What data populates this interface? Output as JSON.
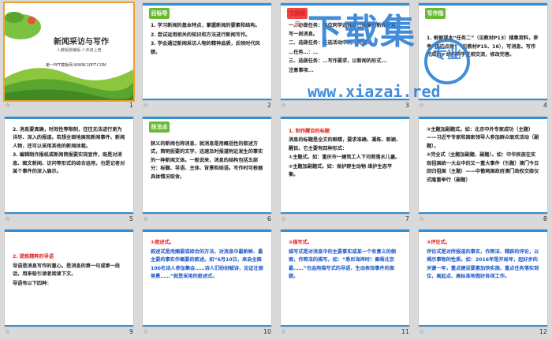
{
  "slides": [
    {
      "num": "1",
      "title": "新闻采访与写作",
      "subtitle": "人教版部编版·八年级上册",
      "footer": "第一PPT模板网-WWW.1PPT.COM"
    },
    {
      "num": "2",
      "badge": "目标导航",
      "lines": [
        "1. 学习新闻的基本特点，掌握新闻的要素和结构。",
        "2. 尝试运用相关的知识和方法进行新闻写作。",
        "3. 学会通过新闻采访人物的精神品质，反映时代风貌。"
      ]
    },
    {
      "num": "3",
      "badge": "文题展示",
      "lines": [
        "一、必做任务：每位同学选择自己搜集的新闻材料，写一则消息。",
        "二、选做任务：任选活动中的...完成...",
        "…任务…：…",
        "三、选做任务：…写作要求，以新闻的形式...",
        "注意事项..."
      ]
    },
    {
      "num": "4",
      "badge": "写作指导",
      "lines": [
        "1. 根据课本“任务二”（见教材P13）搜集资料，参考“技巧点拨”（见教材P15、16），写消息。写作完成后，组内同学互相交流，修改完善。"
      ]
    },
    {
      "num": "5",
      "lines": [
        "2. 消息要真确，时效性等限制，往往无法进行更为详尽、深入的报道。若想全面地展现新闻事件、新闻人物，还可以采用其他的新闻体裁。",
        "3. 编辑制作报纸或新闻简报要实现宣传，既是对消息、图文新闻、访问等形式的综合运用，也是记者对某个事件的深入展示。"
      ]
    },
    {
      "num": "6",
      "badge": "技法点拨",
      "lines": [
        "狭义的新闻也称消息，就消息是用概括性的叙述方式，简明扼要的文字，迅速及时报道附近发生的事实的一种新闻文体。一般说来，消息的结构包括五部分：标题、导语、主体、背景和结语。写作时可根据具体情况取舍。"
      ]
    },
    {
      "num": "7",
      "heading": "1. 制作醒目的标题",
      "lines": [
        "消息的标题是全文的眼睛，要求准确、凝练、新颖、醒目。它主要有四种形式：",
        "①主题式。如：重庆市一建筑工人下河救落水儿童。",
        "②主题加副题式。如：保护野生动物 维护生态平衡。"
      ]
    },
    {
      "num": "8",
      "lines": [
        "③主题加副题式。如：北京中外专家成功（主题）——习近平专家和国家领导人参加群众联欢活动（副题）。",
        "④完全式（主题加副题、副题）。如：中华民族在实现祖国统一大业中的又一重大事件（引题）澳门今日回归祖国（主题）——中葡两国政府澳门政权交接仪式隆重举行（副题）"
      ]
    },
    {
      "num": "9",
      "heading": "2. 提炼精粹的导语",
      "lines": [
        "导语是消息写作的重心。是消息的第一句或第一段话，用来吸引读者阅读下文。",
        "导语有以下四种："
      ]
    },
    {
      "num": "10",
      "lines": [
        "①叙述式。",
        "叙述式是用摘要或综合的方法，对消息中最新鲜、最主要的事实作概要的叙述。如“6月10日，来自全国100名诗人参加集会……诗人们纷纷赋诗，见证壮丽美景……”就是采用的叙述式。"
      ]
    },
    {
      "num": "11",
      "lines": [
        "②描写式。",
        "描写式是对消息中的主要事实或某一个有意义的侧面，作简洁的描写。如：“悉尼海岸时！秦晤北京最……”也运用描写式的导语，生动表现事件的面貌。"
      ]
    },
    {
      "num": "12",
      "lines": [
        "③评论式。",
        "评论式是对所报道的事实，作简洁、精辟的评论，以揭示事物的性质。如：2016年是开局年，起好步的关键一年，重点建设要素加快实施、重点任务落实到位，高起点、高标准地做好各项工作。"
      ]
    }
  ],
  "footer_star": "☆",
  "watermark": {
    "text": "下载集",
    "badge": "专业",
    "url": "www.xiazai.red"
  }
}
